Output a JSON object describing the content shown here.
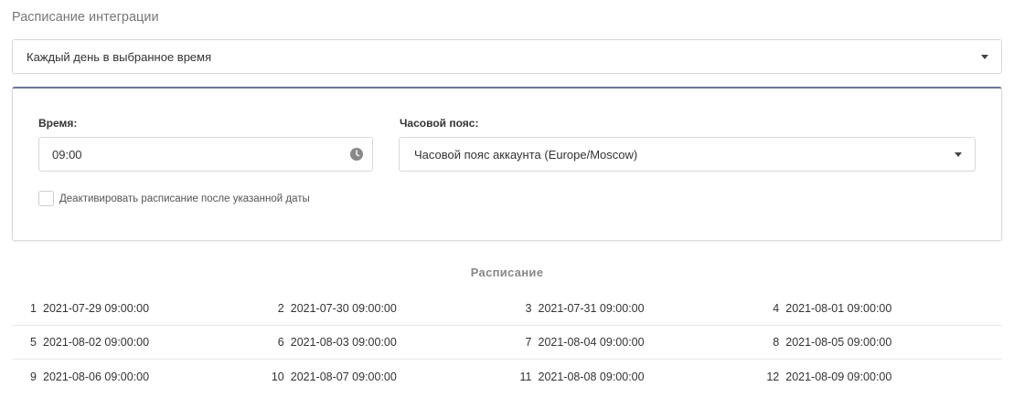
{
  "section_title": "Расписание интеграции",
  "frequency_select": {
    "value": "Каждый день в выбранное время"
  },
  "panel": {
    "time_label": "Время:",
    "time_value": "09:00",
    "timezone_label": "Часовой пояс:",
    "timezone_value": "Часовой пояс аккаунта (Europe/Moscow)",
    "deactivate_label": "Деактивировать расписание после указанной даты",
    "deactivate_checked": false
  },
  "schedule": {
    "title": "Расписание",
    "rows": [
      [
        {
          "n": "1",
          "dt": "2021-07-29 09:00:00"
        },
        {
          "n": "2",
          "dt": "2021-07-30 09:00:00"
        },
        {
          "n": "3",
          "dt": "2021-07-31 09:00:00"
        },
        {
          "n": "4",
          "dt": "2021-08-01 09:00:00"
        }
      ],
      [
        {
          "n": "5",
          "dt": "2021-08-02 09:00:00"
        },
        {
          "n": "6",
          "dt": "2021-08-03 09:00:00"
        },
        {
          "n": "7",
          "dt": "2021-08-04 09:00:00"
        },
        {
          "n": "8",
          "dt": "2021-08-05 09:00:00"
        }
      ],
      [
        {
          "n": "9",
          "dt": "2021-08-06 09:00:00"
        },
        {
          "n": "10",
          "dt": "2021-08-07 09:00:00"
        },
        {
          "n": "11",
          "dt": "2021-08-08 09:00:00"
        },
        {
          "n": "12",
          "dt": "2021-08-09 09:00:00"
        }
      ]
    ]
  },
  "colors": {
    "panel_top_border": "#6b7594",
    "muted_text": "#777777",
    "icon": "#888888"
  },
  "icons": {
    "select_caret": "chevron-down-icon",
    "time": "clock-icon"
  }
}
